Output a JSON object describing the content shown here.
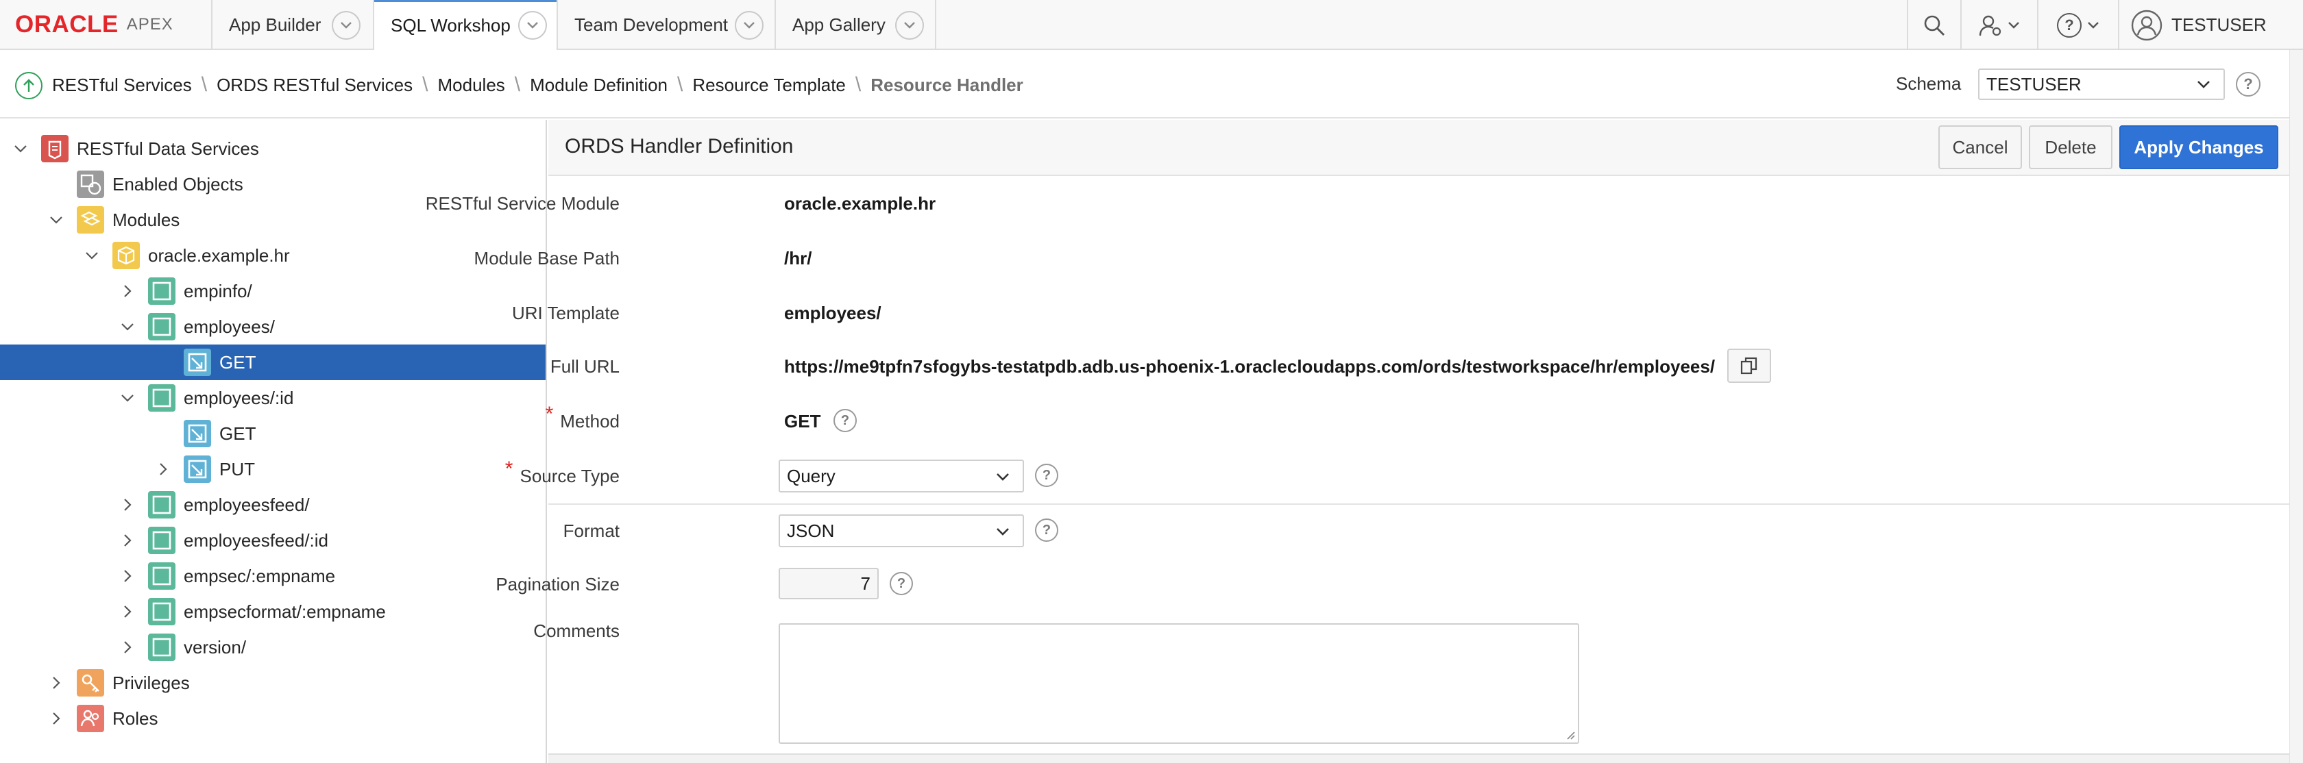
{
  "app": {
    "brand_oracle": "ORACLE",
    "brand_apex": "APEX"
  },
  "nav": {
    "tabs": [
      {
        "label": "App Builder"
      },
      {
        "label": "SQL Workshop"
      },
      {
        "label": "Team Development"
      },
      {
        "label": "App Gallery"
      }
    ],
    "active_tab": "SQL Workshop",
    "user": "TESTUSER"
  },
  "breadcrumb": {
    "items": [
      "RESTful Services",
      "ORDS RESTful Services",
      "Modules",
      "Module Definition",
      "Resource Template",
      "Resource Handler"
    ],
    "schema_label": "Schema",
    "schema_value": "TESTUSER"
  },
  "tree": {
    "nodes": [
      {
        "label": "RESTful Data Services",
        "icon": "database-service-icon",
        "toggle": "expanded"
      },
      {
        "label": "Enabled Objects",
        "icon": "enabled-objects-icon",
        "toggle": "none"
      },
      {
        "label": "Modules",
        "icon": "modules-icon",
        "toggle": "expanded"
      },
      {
        "label": "oracle.example.hr",
        "icon": "module-box-icon",
        "toggle": "expanded"
      },
      {
        "label": "empinfo/",
        "icon": "template-icon",
        "toggle": "collapsed"
      },
      {
        "label": "employees/",
        "icon": "template-icon",
        "toggle": "expanded"
      },
      {
        "label": "GET",
        "icon": "handler-icon",
        "toggle": "none",
        "selected": true
      },
      {
        "label": "employees/:id",
        "icon": "template-icon",
        "toggle": "expanded"
      },
      {
        "label": "GET",
        "icon": "handler-icon",
        "toggle": "none"
      },
      {
        "label": "PUT",
        "icon": "handler-icon",
        "toggle": "collapsed"
      },
      {
        "label": "employeesfeed/",
        "icon": "template-icon",
        "toggle": "collapsed"
      },
      {
        "label": "employeesfeed/:id",
        "icon": "template-icon",
        "toggle": "collapsed"
      },
      {
        "label": "empsec/:empname",
        "icon": "template-icon",
        "toggle": "collapsed"
      },
      {
        "label": "empsecformat/:empname",
        "icon": "template-icon",
        "toggle": "collapsed"
      },
      {
        "label": "version/",
        "icon": "template-icon",
        "toggle": "collapsed"
      },
      {
        "label": "Privileges",
        "icon": "privileges-key-icon",
        "toggle": "collapsed"
      },
      {
        "label": "Roles",
        "icon": "roles-icon",
        "toggle": "collapsed"
      }
    ]
  },
  "panel": {
    "title": "ORDS Handler Definition",
    "cancel_label": "Cancel",
    "delete_label": "Delete",
    "apply_label": "Apply Changes"
  },
  "form": {
    "module_label": "RESTful Service Module",
    "module_value": "oracle.example.hr",
    "base_path_label": "Module Base Path",
    "base_path_value": "/hr/",
    "uri_template_label": "URI Template",
    "uri_template_value": "employees/",
    "full_url_label": "Full URL",
    "full_url_value": "https://me9tpfn7sfogybs-testatpdb.adb.us-phoenix-1.oraclecloudapps.com/ords/testworkspace/hr/employees/",
    "method_label": "Method",
    "method_value": "GET",
    "source_type_label": "Source Type",
    "source_type_value": "Query",
    "format_label": "Format",
    "format_value": "JSON",
    "pagination_label": "Pagination Size",
    "pagination_value": "7",
    "comments_label": "Comments",
    "comments_value": ""
  },
  "colors": {
    "accent": "#2f73d6",
    "selected_row": "#2964b4",
    "oracle_red": "#e4262a",
    "required": "#e0211b"
  }
}
